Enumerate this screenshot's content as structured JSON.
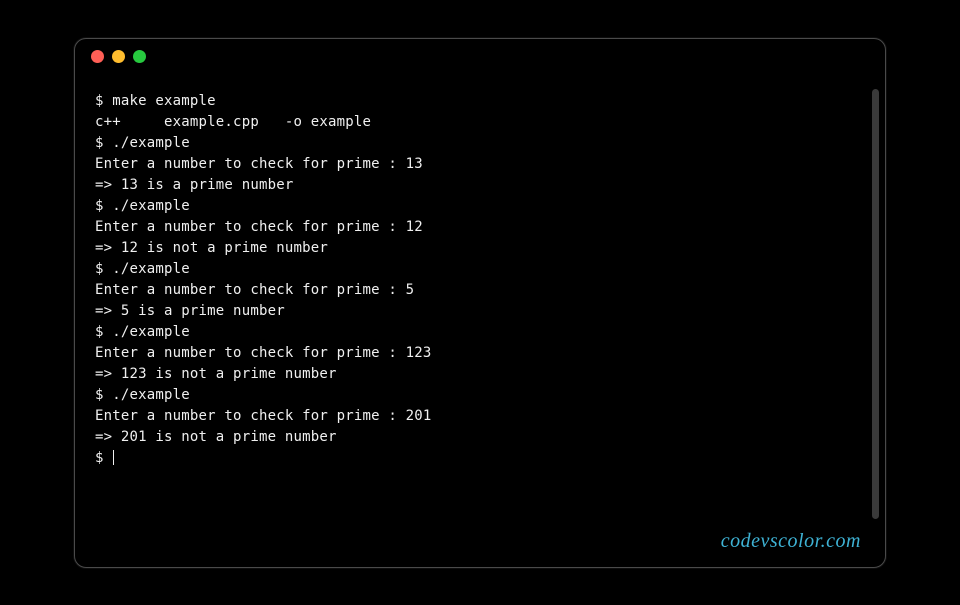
{
  "terminal": {
    "lines": [
      "$ make example",
      "c++     example.cpp   -o example",
      "$ ./example",
      "Enter a number to check for prime : 13",
      "=> 13 is a prime number",
      "$ ./example",
      "Enter a number to check for prime : 12",
      "=> 12 is not a prime number",
      "$ ./example",
      "Enter a number to check for prime : 5",
      "=> 5 is a prime number",
      "$ ./example",
      "Enter a number to check for prime : 123",
      "=> 123 is not a prime number",
      "$ ./example",
      "Enter a number to check for prime : 201",
      "=> 201 is not a prime number"
    ],
    "prompt": "$ "
  },
  "watermark": "codevscolor.com"
}
